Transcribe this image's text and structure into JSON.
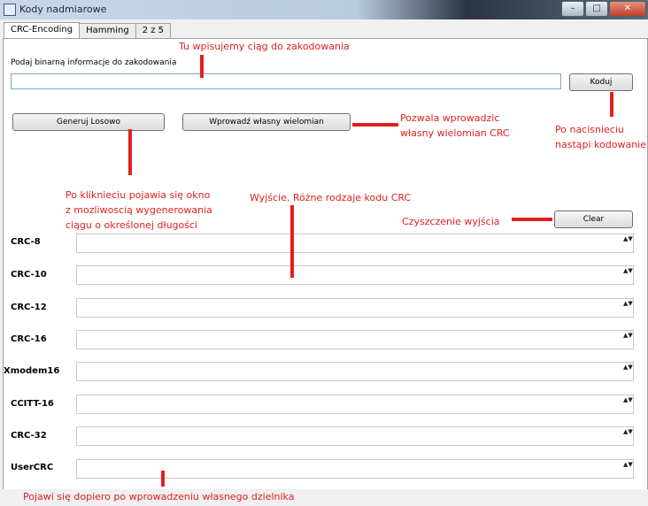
{
  "window": {
    "title": "Kody nadmiarowe",
    "btn_min": "–",
    "btn_max": "□",
    "btn_close": "✕"
  },
  "tabs": [
    {
      "label": "CRC-Encoding",
      "active": true
    },
    {
      "label": "Hamming",
      "active": false
    },
    {
      "label": "2 z 5",
      "active": false
    }
  ],
  "input": {
    "label": "Podaj binarną informacje do zakodowania",
    "value": ""
  },
  "buttons": {
    "encode": "Koduj",
    "random": "Generuj Losowo",
    "polynomial": "Wprowadź własny wielomian",
    "clear": "Clear"
  },
  "outputs": [
    {
      "label": "CRC-8",
      "value": ""
    },
    {
      "label": "CRC-10",
      "value": ""
    },
    {
      "label": "CRC-12",
      "value": ""
    },
    {
      "label": "CRC-16",
      "value": ""
    },
    {
      "label": "Xmodem16",
      "value": ""
    },
    {
      "label": "CCITT-16",
      "value": ""
    },
    {
      "label": "CRC-32",
      "value": ""
    },
    {
      "label": "UserCRC",
      "value": ""
    }
  ],
  "spin_glyph": "▲▼",
  "annotations": {
    "input_note": "Tu wpisujemy ciąg do zakodowania",
    "polynomial_note_1": "Pozwala wprowadzic",
    "polynomial_note_2": "własny wielomian CRC",
    "encode_note_1": "Po nacisnieciu",
    "encode_note_2": "nastąpi kodowanie",
    "random_note_1": "Po kliknieciu pojawia się okno",
    "random_note_2": "z mozliwoscią wygenerowania",
    "random_note_3": "ciągu o określonej długości",
    "outputs_note": "Wyjście.  Różne rodzaje kodu CRC",
    "clear_note": "Czyszczenie wyjścia",
    "usercrc_note": "Pojawi się dopiero po wprowadzeniu własnego dzielnika"
  },
  "colors": {
    "annotation": "#e02020",
    "input_border": "#7aa8c8"
  }
}
